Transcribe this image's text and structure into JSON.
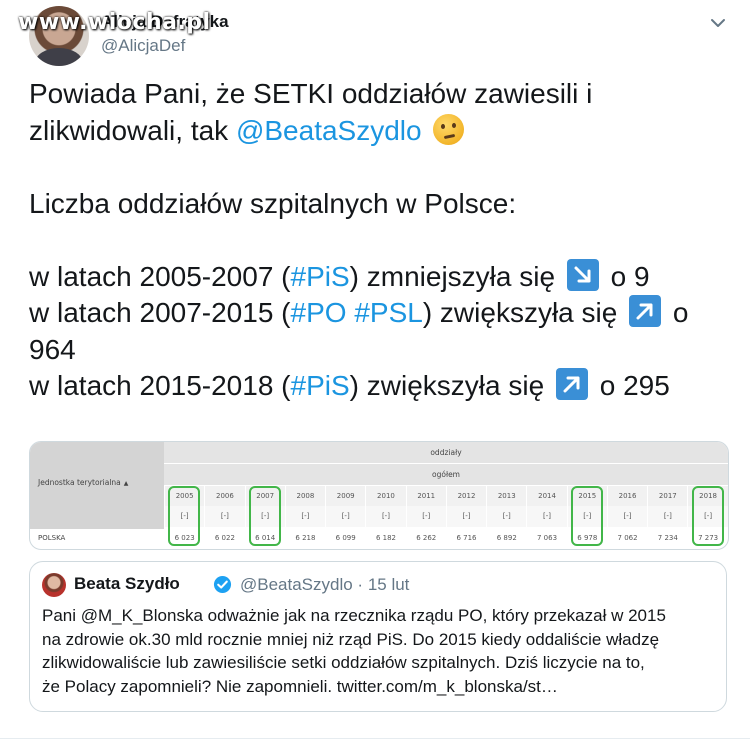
{
  "watermark": "www.wiocha.pl",
  "author": {
    "name": "Alicja Dafratyka",
    "handle": "@AlicjaDef"
  },
  "tweet": {
    "p1_a": "Powiada Pani, że SETKI oddziałów zawiesili i",
    "p1_b": "zlikwidowali, tak ",
    "p1_mention": "@BeataSzydlo",
    "p2": "Liczba oddziałów szpitalnych w Polsce:",
    "l1_a": "w latach 2005-2007 (",
    "l1_tag": "#PiS",
    "l1_b": ") zmniejszyła się ",
    "l1_c": " o 9",
    "l2_a": "w latach 2007-2015 (",
    "l2_tag1": "#PO",
    "l2_sp": " ",
    "l2_tag2": "#PSL",
    "l2_b": ") zwiększyła się ",
    "l2_c": " o",
    "l2_d": "964",
    "l3_a": "w latach 2015-2018 (",
    "l3_tag": "#PiS",
    "l3_b": ") zwiększyła się ",
    "l3_c": " o 295"
  },
  "table": {
    "header_top": "oddziały",
    "header_sub": "ogółem",
    "left_header": "Jednostka terytorialna",
    "sort_symbol": "▲",
    "row_label": "POLSKA",
    "years": [
      "2005",
      "2006",
      "2007",
      "2008",
      "2009",
      "2010",
      "2011",
      "2012",
      "2013",
      "2014",
      "2015",
      "2016",
      "2017",
      "2018"
    ],
    "brackets": [
      "[-]",
      "[-]",
      "[-]",
      "[-]",
      "[-]",
      "[-]",
      "[-]",
      "[-]",
      "[-]",
      "[-]",
      "[-]",
      "[-]",
      "[-]",
      "[-]"
    ],
    "values": [
      "6 023",
      "6 022",
      "6 014",
      "6 218",
      "6 099",
      "6 182",
      "6 262",
      "6 716",
      "6 892",
      "7 063",
      "6 978",
      "7 062",
      "7 234",
      "7 273"
    ],
    "highlight_color": "#42b649"
  },
  "quote": {
    "name": "Beata Szydło",
    "handle_time": "@BeataSzydlo · 15 lut",
    "lines": [
      "Pani @M_K_Blonska odważnie jak na rzecznika rządu PO, który przekazał w 2015",
      "na zdrowie ok.30 mld rocznie mniej niż rząd PiS. Do 2015 kiedy oddaliście władzę",
      "zlikwidowaliście lub zawiesiliście setki oddziałów szpitalnych. Dziś liczycie na to,",
      "że Polacy zapomnieli? Nie zapomnieli. twitter.com/m_k_blonska/st…"
    ]
  },
  "colors": {
    "link": "#1b95e0",
    "secondary": "#657786",
    "arrow_box": "#3a8fd6",
    "verified": "#1da1f2"
  },
  "icons": {
    "menu": "chevron-down-icon",
    "down_right": "arrow-down-right-icon",
    "up_right": "arrow-up-right-icon",
    "think": "thinking-face-emoji",
    "verified": "verified-badge-icon"
  }
}
